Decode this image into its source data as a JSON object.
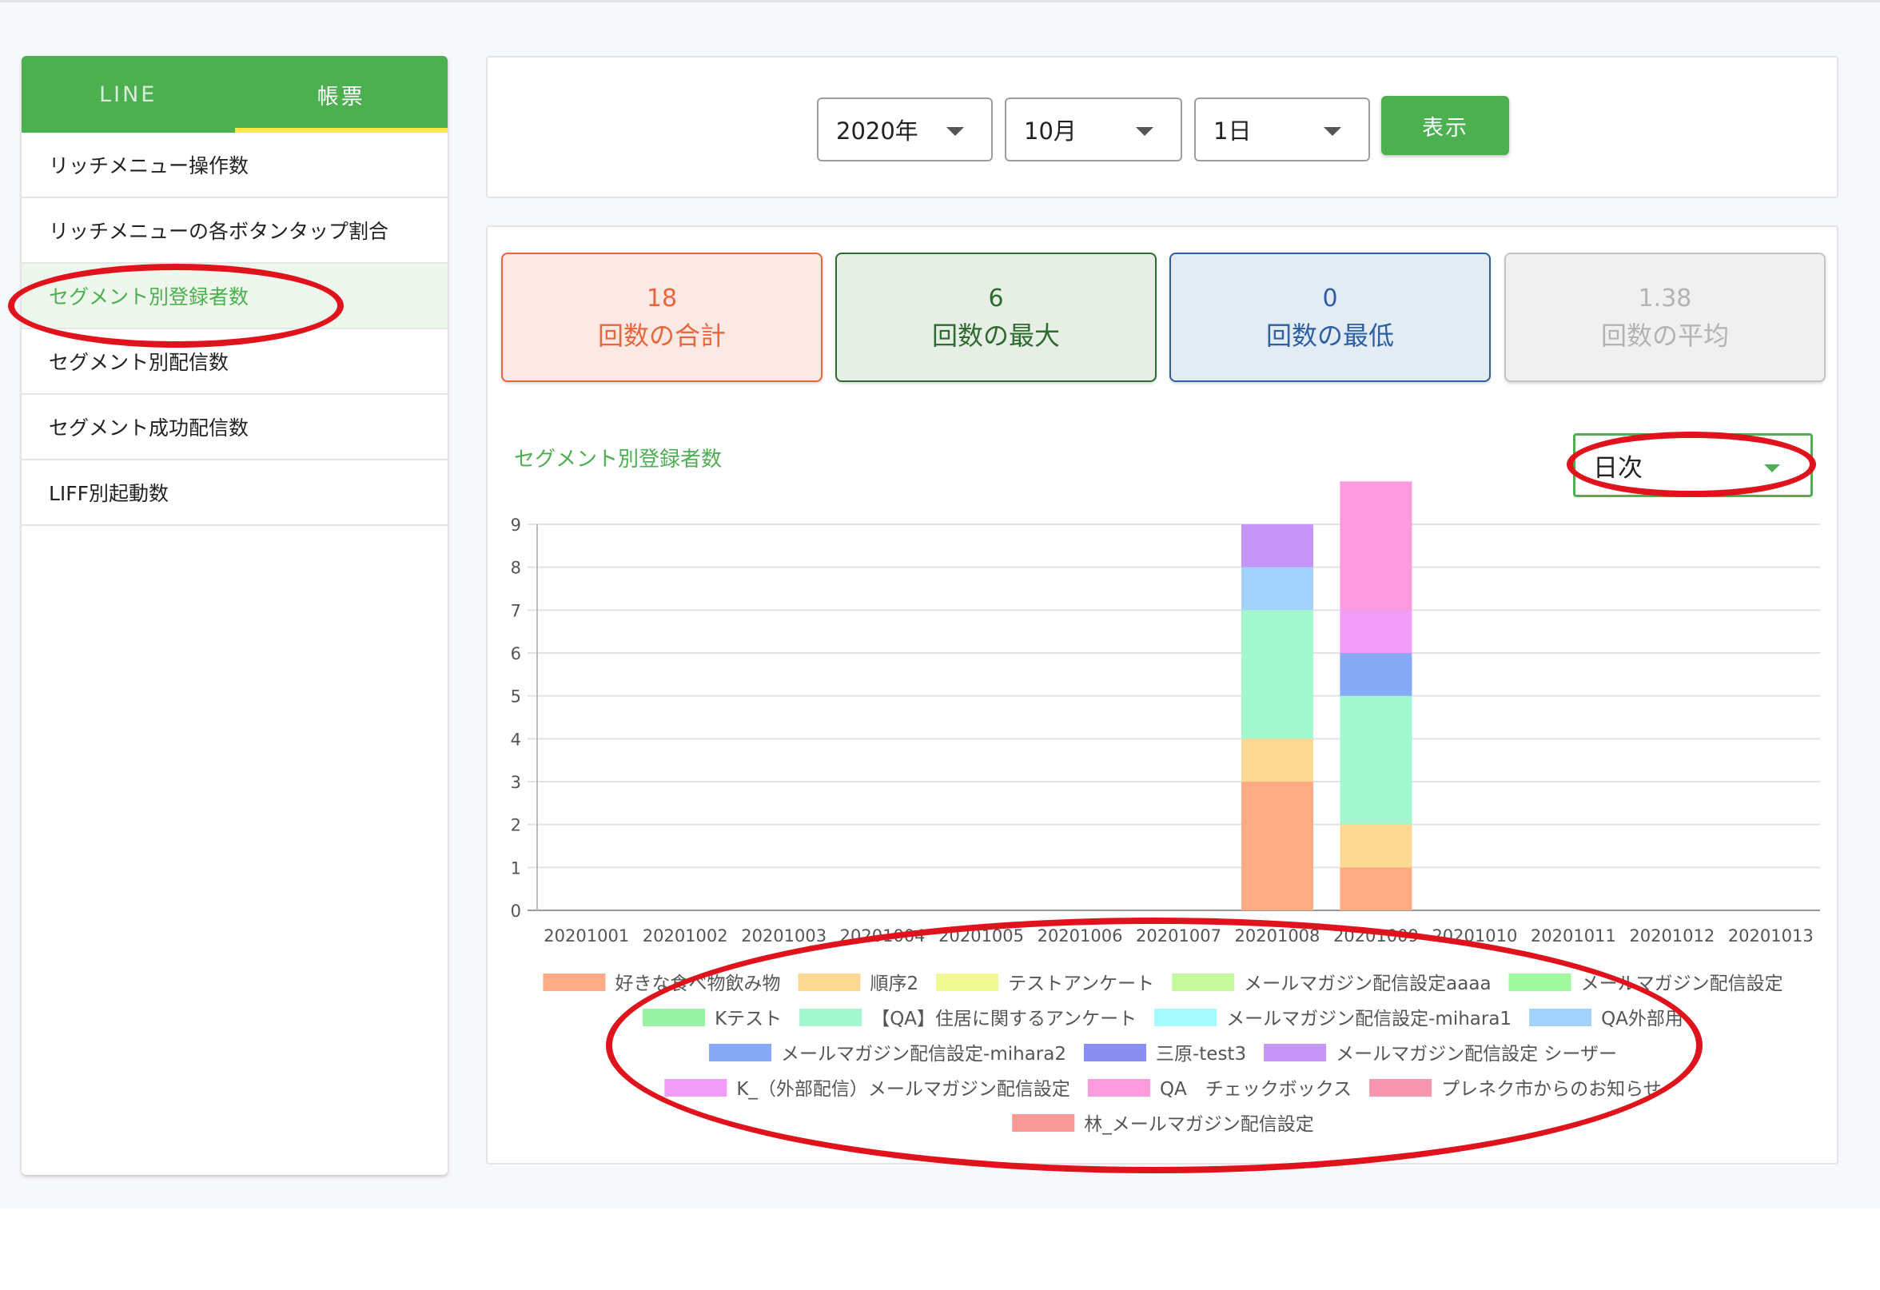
{
  "sidebar": {
    "tabs": [
      {
        "label": "LINE",
        "active": false
      },
      {
        "label": "帳票",
        "active": true
      }
    ],
    "items": [
      {
        "label": "リッチメニュー操作数",
        "active": false
      },
      {
        "label": "リッチメニューの各ボタンタップ割合",
        "active": false
      },
      {
        "label": "セグメント別登録者数",
        "active": true
      },
      {
        "label": "セグメント別配信数",
        "active": false
      },
      {
        "label": "セグメント成功配信数",
        "active": false
      },
      {
        "label": "LIFF別起動数",
        "active": false
      }
    ]
  },
  "filters": {
    "year": "2020年",
    "month": "10月",
    "day": "1日",
    "show_label": "表示"
  },
  "stats": {
    "sum": {
      "value": "18",
      "label": "回数の合計"
    },
    "max": {
      "value": "6",
      "label": "回数の最大"
    },
    "min": {
      "value": "0",
      "label": "回数の最低"
    },
    "avg": {
      "value": "1.38",
      "label": "回数の平均"
    }
  },
  "chart_title": "セグメント別登録者数",
  "period": {
    "selected": "日次"
  },
  "colors": {
    "brand_green": "#4caf50",
    "annotation_red": "#e0121b"
  },
  "chart_data": {
    "type": "bar",
    "stacked": true,
    "categories": [
      "20201001",
      "20201002",
      "20201003",
      "20201004",
      "20201005",
      "20201006",
      "20201007",
      "20201008",
      "20201009",
      "20201010",
      "20201011",
      "20201012",
      "20201013"
    ],
    "ylim": [
      0,
      9
    ],
    "yticks": [
      0,
      1,
      2,
      3,
      4,
      5,
      6,
      7,
      8,
      9
    ],
    "grid": true,
    "legend_position": "bottom",
    "series": [
      {
        "name": "好きな食べ物飲み物",
        "color": "#fdab85",
        "values": [
          0,
          0,
          0,
          0,
          0,
          0,
          0,
          3,
          1,
          0,
          0,
          0,
          0
        ]
      },
      {
        "name": "順序2",
        "color": "#fcd993",
        "values": [
          0,
          0,
          0,
          0,
          0,
          0,
          0,
          1,
          1,
          0,
          0,
          0,
          0
        ]
      },
      {
        "name": "テストアンケート",
        "color": "#f0f993",
        "values": [
          0,
          0,
          0,
          0,
          0,
          0,
          0,
          0,
          0,
          0,
          0,
          0,
          0
        ]
      },
      {
        "name": "メールマガジン配信設定aaaa",
        "color": "#c6f99b",
        "values": [
          0,
          0,
          0,
          0,
          0,
          0,
          0,
          0,
          0,
          0,
          0,
          0,
          0
        ]
      },
      {
        "name": "メールマガジン配信設定",
        "color": "#9ef99f",
        "values": [
          0,
          0,
          0,
          0,
          0,
          0,
          0,
          0,
          0,
          0,
          0,
          0,
          0
        ]
      },
      {
        "name": "Kテスト",
        "color": "#98f2a4",
        "values": [
          0,
          0,
          0,
          0,
          0,
          0,
          0,
          0,
          0,
          0,
          0,
          0,
          0
        ]
      },
      {
        "name": "【QA】住居に関するアンケート",
        "color": "#a3f8d0",
        "values": [
          0,
          0,
          0,
          0,
          0,
          0,
          0,
          3,
          3,
          0,
          0,
          0,
          0
        ]
      },
      {
        "name": "メールマガジン配信設定-mihara1",
        "color": "#a4fbfb",
        "values": [
          0,
          0,
          0,
          0,
          0,
          0,
          0,
          0,
          0,
          0,
          0,
          0,
          0
        ]
      },
      {
        "name": "QA外部用",
        "color": "#a1d3fc",
        "values": [
          0,
          0,
          0,
          0,
          0,
          0,
          0,
          1,
          0,
          0,
          0,
          0,
          0
        ]
      },
      {
        "name": "メールマガジン配信設定-mihara2",
        "color": "#88a9f6",
        "values": [
          0,
          0,
          0,
          0,
          0,
          0,
          0,
          0,
          1,
          0,
          0,
          0,
          0
        ]
      },
      {
        "name": "三原-test3",
        "color": "#8b8ff2",
        "values": [
          0,
          0,
          0,
          0,
          0,
          0,
          0,
          0,
          0,
          0,
          0,
          0,
          0
        ]
      },
      {
        "name": "メールマガジン配信設定 シーザー",
        "color": "#c496f7",
        "values": [
          0,
          0,
          0,
          0,
          0,
          0,
          0,
          1,
          0,
          0,
          0,
          0,
          0
        ]
      },
      {
        "name": "K_（外部配信）メールマガジン配信設定",
        "color": "#f19cf6",
        "values": [
          0,
          0,
          0,
          0,
          0,
          0,
          0,
          0,
          1,
          0,
          0,
          0,
          0
        ]
      },
      {
        "name": "QA　チェックボックス",
        "color": "#fc9ade",
        "values": [
          0,
          0,
          0,
          0,
          0,
          0,
          0,
          0,
          3,
          0,
          0,
          0,
          0
        ]
      },
      {
        "name": "プレネク市からのお知らせ",
        "color": "#f995b1",
        "values": [
          0,
          0,
          0,
          0,
          0,
          0,
          0,
          0,
          0,
          0,
          0,
          0,
          0
        ]
      },
      {
        "name": "林_メールマガジン配信設定",
        "color": "#f79796",
        "values": [
          0,
          0,
          0,
          0,
          0,
          0,
          0,
          0,
          0,
          0,
          0,
          0,
          0
        ]
      }
    ]
  }
}
